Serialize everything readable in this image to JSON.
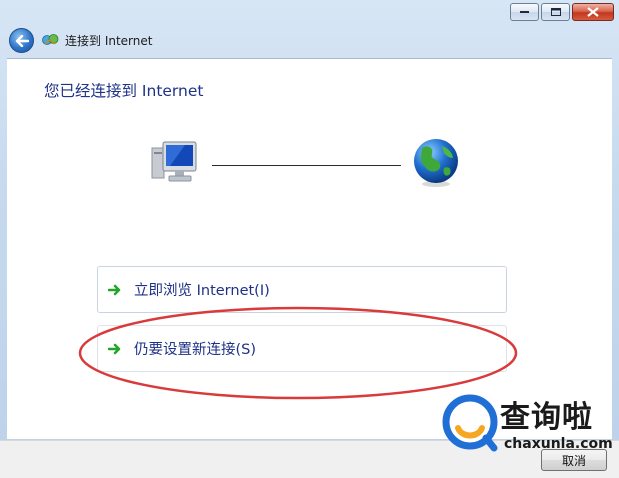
{
  "window": {
    "title": "连接到 Internet",
    "controls": [
      "minimize-icon",
      "maximize-icon",
      "close-icon"
    ]
  },
  "main": {
    "heading": "您已经连接到 Internet",
    "diagram": {
      "left_icon": "computer-icon",
      "right_icon": "globe-icon"
    },
    "options": [
      {
        "label": "立即浏览 Internet(I)",
        "icon": "green-arrow-icon"
      },
      {
        "label": "仍要设置新连接(S)",
        "icon": "green-arrow-icon"
      }
    ],
    "annotation_color": "#d93a3a"
  },
  "footer": {
    "cancel_label": "取消"
  },
  "watermark": {
    "brand": "查询啦",
    "domain": "chaxunla.com",
    "colors": [
      "#1f6fd6",
      "#f5a623"
    ]
  }
}
